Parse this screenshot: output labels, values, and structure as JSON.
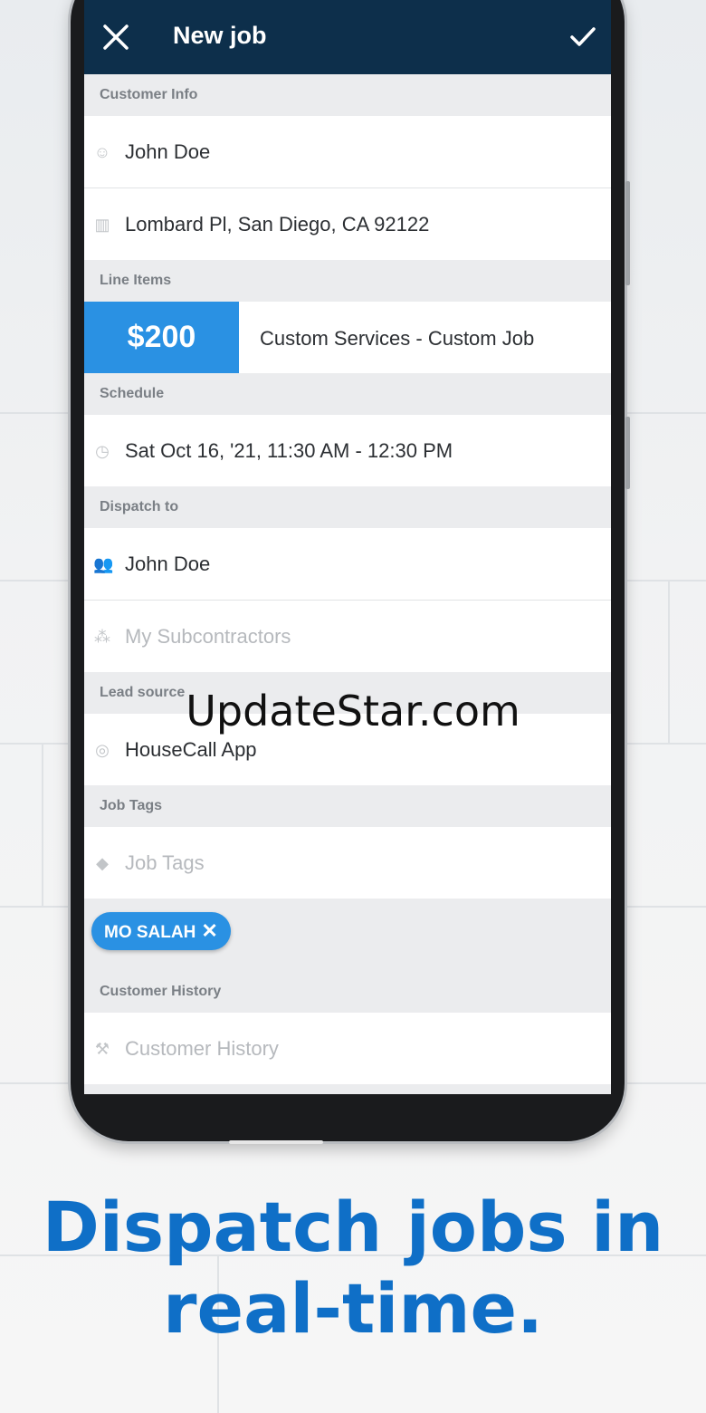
{
  "app": {
    "title": "New job",
    "close_icon": "close-icon",
    "confirm_icon": "check-icon"
  },
  "sections": {
    "customer_info": "Customer Info",
    "line_items": "Line Items",
    "schedule": "Schedule",
    "dispatch_to": "Dispatch to",
    "lead_source": "Lead source",
    "job_tags": "Job Tags",
    "customer_history": "Customer History"
  },
  "customer": {
    "name": "John Doe",
    "address": "Lombard Pl, San Diego, CA 92122"
  },
  "line_item": {
    "price": "$200",
    "description": "Custom Services - Custom Job"
  },
  "schedule": {
    "time": "Sat Oct 16, '21, 11:30 AM - 12:30 PM"
  },
  "dispatch": {
    "employee": "John Doe",
    "subcontractors_placeholder": "My Subcontractors"
  },
  "lead_source": {
    "value": "HouseCall App"
  },
  "job_tags": {
    "placeholder": "Job Tags",
    "chip_label": "MO SALAH",
    "chip_remove": "✕"
  },
  "customer_history": {
    "placeholder": "Customer History"
  },
  "watermark": "UpdateStar.com",
  "caption": {
    "line1": "Dispatch jobs in",
    "line2": "real-time."
  },
  "colors": {
    "appbar": "#0d2f4b",
    "accent": "#2a91e3",
    "caption": "#0f6fc7"
  }
}
